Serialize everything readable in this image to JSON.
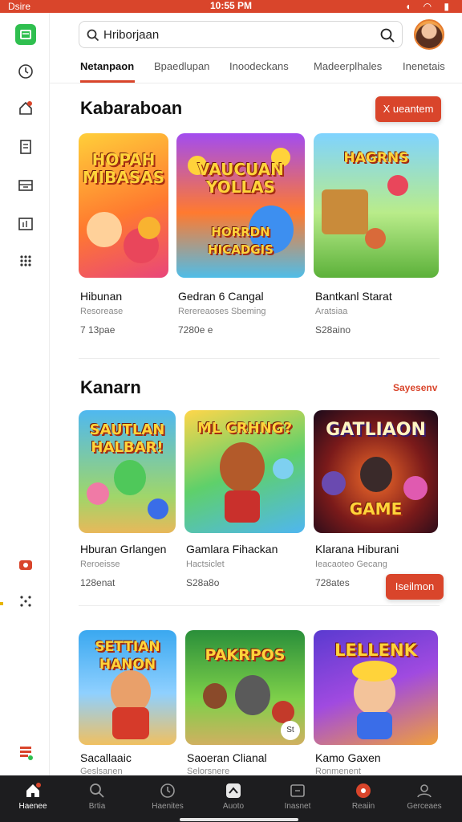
{
  "status": {
    "carrier": "Dsire",
    "time": "10:55 PM"
  },
  "search": {
    "query": "Hriborjaan"
  },
  "tabs": [
    "Netanpaon",
    "Bpaedlupan",
    "Inoodeckans",
    "Madeerplhales",
    "Inenetais"
  ],
  "section1": {
    "title": "Kabaraboan",
    "button": "X ueantem",
    "cards": [
      {
        "art_title": "HOPAH MIBASAS",
        "title": "Hibunan",
        "sub": "Resorease",
        "meta": "7 13pae"
      },
      {
        "art_title": "VAUCUAN YOLLAS",
        "art_sub": "HORRDN HICADGIS",
        "title": "Gedran 6 Cangal",
        "sub": "Rerereaoses Sbeming",
        "meta": "7280e e"
      },
      {
        "art_title": "HAGRNS",
        "title": "Bantkanl Starat",
        "sub": "Aratsiaa",
        "meta": "S28aino"
      }
    ]
  },
  "section2": {
    "title": "Kanarn",
    "link": "Sayesenv",
    "button": "Iseilmon",
    "cards": [
      {
        "art_title": "SAUTLAN HALBAR!",
        "title": "Hburan Grlangen",
        "sub": "Reroeisse",
        "meta": "128enat"
      },
      {
        "art_title": "ML CRHNG?",
        "title": "Gamlara Fihackan",
        "sub": "Hactsiclet",
        "meta": "S28a8o"
      },
      {
        "art_title": "GATLIAON",
        "art_sub": "GAME",
        "title": "Klarana Hiburani",
        "sub": "Ieacaoteo Gecang",
        "meta": "728ates"
      }
    ]
  },
  "section3": {
    "cards": [
      {
        "art_title": "SETTIAN HANON",
        "title": "Sacallaaic",
        "sub": "Geslsanen"
      },
      {
        "art_title": "PAKRPOS",
        "title": "Saoeran Clianal",
        "sub": "Selorsnere",
        "badge": "St"
      },
      {
        "art_title": "LELLENK",
        "title": "Kamo Gaxen",
        "sub": "Ronmenent"
      }
    ]
  },
  "bottom_nav": [
    "Haenee",
    "Brtia",
    "Haenites",
    "Auoto",
    "Inasnet",
    "Reaiin",
    "Gerceaes"
  ],
  "icons": {
    "rail": [
      "app-logo-icon",
      "clock-icon",
      "home-alert-icon",
      "document-icon",
      "inbox-icon",
      "chart-icon",
      "grid-dots-icon",
      "camera-icon",
      "dots-icon",
      "list-icon"
    ],
    "bottom": [
      "home-icon",
      "search-icon",
      "clock-icon",
      "app-icon",
      "tv-icon",
      "record-icon",
      "user-icon"
    ]
  },
  "colors": {
    "accent": "#d9452b",
    "nav_bg": "#1d1d1f",
    "logo_green": "#2fbf4f"
  }
}
